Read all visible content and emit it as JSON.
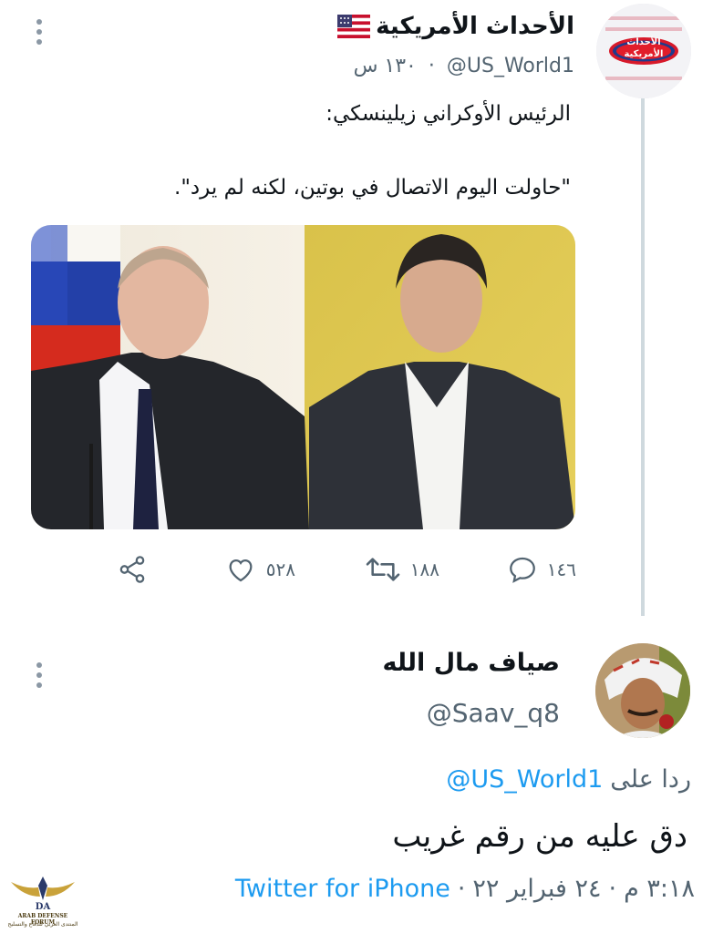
{
  "tweet1": {
    "display_name": "الأحداث الأمريكية",
    "handle": "@US_World1",
    "time_ago": "١٣٠ س",
    "avatar_text": "الأحداث الأمريكية",
    "body_line1": "الرئيس الأوكراني زيلينسكي:",
    "body_line2": "\"حاولت اليوم الاتصال في بوتين، لكنه لم يرد\".",
    "replies": "١٤٦",
    "retweets": "١٨٨",
    "likes": "٥٢٨",
    "icons": [
      "flag-us-icon",
      "more-icon",
      "reply-icon",
      "retweet-icon",
      "like-icon",
      "share-icon"
    ]
  },
  "tweet2": {
    "display_name": "صياف مال الله",
    "handle": "@Saav_q8",
    "replying_to_label": "ردا على",
    "replying_to_handle": "@US_World1",
    "body": "دق عليه من رقم غريب",
    "time": "٣:١٨ م",
    "date": "٢٤ فبراير ٢٢",
    "separator": "·",
    "client": "Twitter for iPhone"
  },
  "watermark": {
    "line1": "ARAB DEFENSE FORUM",
    "line2": "المنتدى العربي للدفاع والتسليح",
    "mark": "DA"
  },
  "colors": {
    "link": "#1d9bf0",
    "secondary_text": "#536471",
    "thread_line": "#cfd9de"
  }
}
